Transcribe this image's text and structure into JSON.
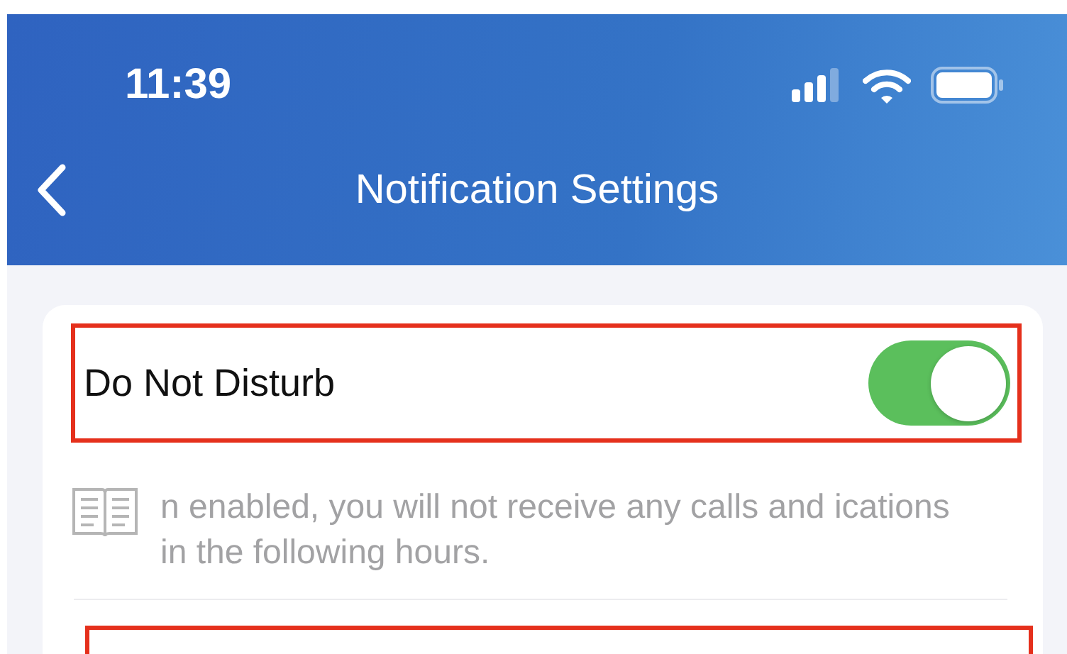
{
  "status_bar": {
    "time": "11:39"
  },
  "nav": {
    "title": "Notification Settings"
  },
  "do_not_disturb": {
    "label": "Do Not Disturb",
    "on": true
  },
  "note": "n enabled, you will not receive any calls and ications in the following hours."
}
